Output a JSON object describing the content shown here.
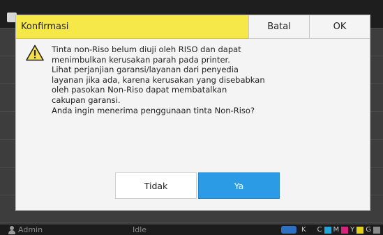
{
  "dialog": {
    "title": "Konfirmasi",
    "cancel_label": "Batal",
    "ok_label": "OK",
    "message_lines": [
      "Tinta non-Riso belum diuji oleh RISO dan dapat",
      "menimbulkan kerusakan parah pada printer.",
      "Lihat perjanjian garansi/layanan dari penyedia",
      "layanan jika ada, karena kerusakan yang disebabkan",
      "oleh pasokan Non-Riso dapat membatalkan",
      "cakupan garansi.",
      "Anda ingin menerima penggunaan tinta Non-Riso?"
    ],
    "no_label": "Tidak",
    "yes_label": "Ya",
    "icon": "warning-icon"
  },
  "status_bar": {
    "user": "Admin",
    "state": "Idle",
    "inks": [
      {
        "label": "K",
        "color": "#1a1a1a"
      },
      {
        "label": "C",
        "color": "#1fa6d6"
      },
      {
        "label": "M",
        "color": "#d4257a"
      },
      {
        "label": "Y",
        "color": "#e3cf1e"
      },
      {
        "label": "G",
        "color": "#8a8a8a"
      }
    ]
  },
  "colors": {
    "title_bar": "#f7e84a",
    "primary_button": "#2b9be6"
  }
}
